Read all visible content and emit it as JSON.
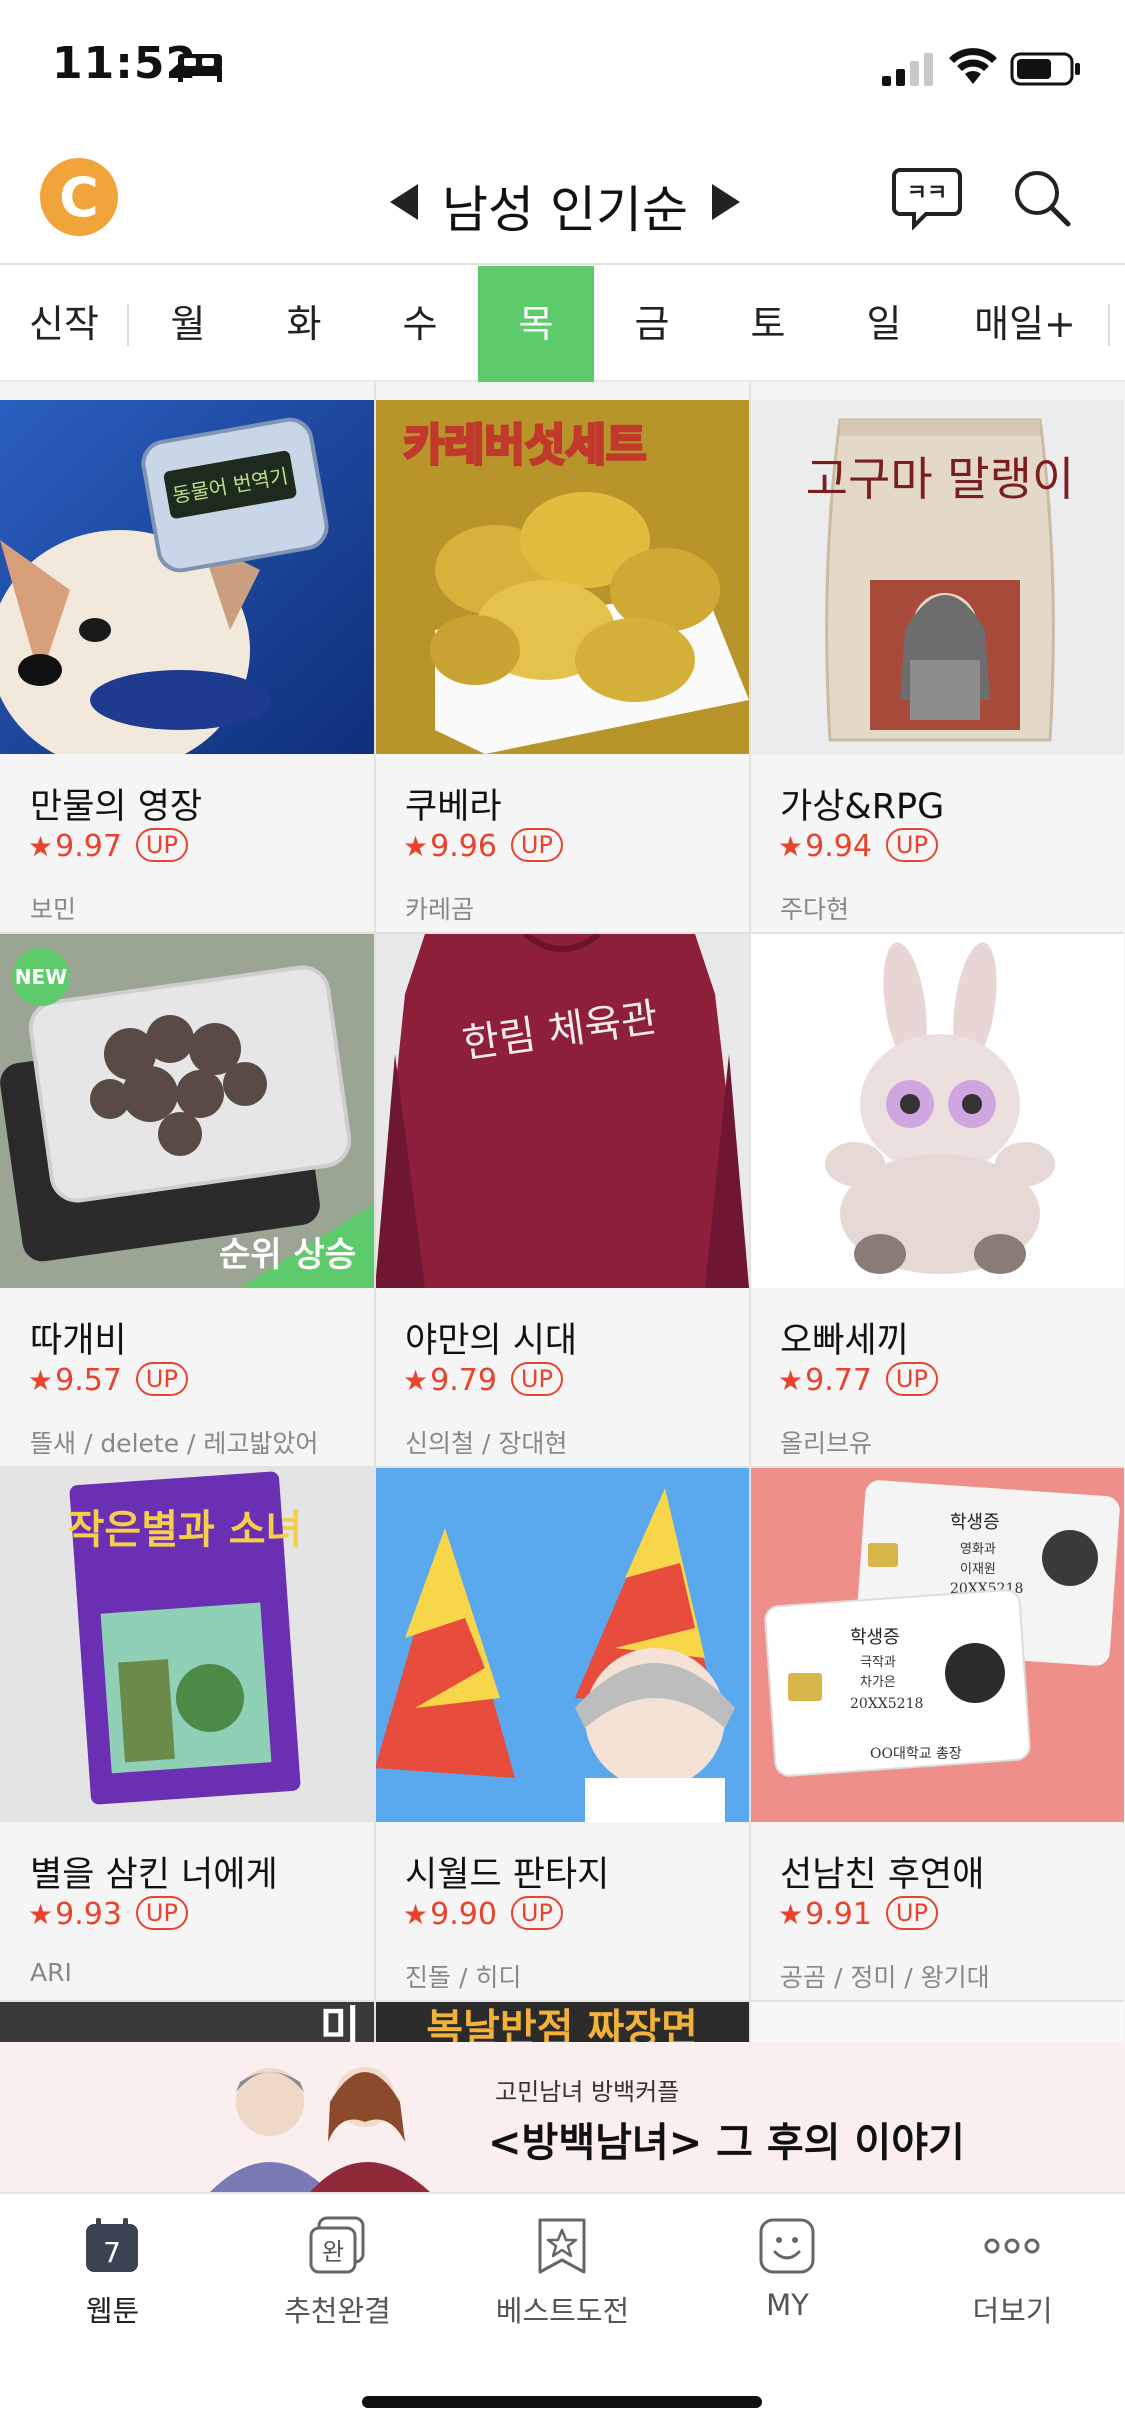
{
  "status": {
    "time": "11:52"
  },
  "header": {
    "logo_letter": "C",
    "title": "남성 인기순"
  },
  "tabs": [
    {
      "label": "신작"
    },
    {
      "label": "월"
    },
    {
      "label": "화"
    },
    {
      "label": "수"
    },
    {
      "label": "목"
    },
    {
      "label": "금"
    },
    {
      "label": "토"
    },
    {
      "label": "일"
    },
    {
      "label": "매일+"
    }
  ],
  "active_tab": "목",
  "comics": [
    {
      "title": "만물의 영장",
      "rating": "9.97",
      "badge": "UP",
      "author": "보민",
      "thumb_text": "동물어 번역기"
    },
    {
      "title": "쿠베라",
      "rating": "9.96",
      "badge": "UP",
      "author": "카레곰",
      "thumb_text": "카레버섯세트"
    },
    {
      "title": "가상&RPG",
      "rating": "9.94",
      "badge": "UP",
      "author": "주다현",
      "thumb_text": "고구마 말랭이"
    },
    {
      "title": "따개비",
      "rating": "9.57",
      "badge": "UP",
      "author": "뜰새 / delete / 레고밟았어",
      "new": "NEW",
      "rank_text": "순위 상승"
    },
    {
      "title": "야만의 시대",
      "rating": "9.79",
      "badge": "UP",
      "author": "신의철 / 장대현",
      "thumb_text": "한림 체육관"
    },
    {
      "title": "오빠세끼",
      "rating": "9.77",
      "badge": "UP",
      "author": "올리브유"
    },
    {
      "title": "별을 삼킨 너에게",
      "rating": "9.93",
      "badge": "UP",
      "author": "ARI",
      "thumb_text": "작은별과 소녀"
    },
    {
      "title": "시월드 판타지",
      "rating": "9.90",
      "badge": "UP",
      "author": "진돌 / 히디"
    },
    {
      "title": "선남친 후연애",
      "rating": "9.91",
      "badge": "UP",
      "author": "공곰 / 정미 / 왕기대",
      "card_text": [
        "학생증",
        "영화과",
        "이재원",
        "20XX5218",
        "학생증",
        "극작과",
        "차가은",
        "20XX5218",
        "OO대학교 총장"
      ]
    },
    {
      "thumb_text": "미"
    },
    {
      "thumb_text": "복날반점 짜장면"
    }
  ],
  "banner": {
    "small": "고민남녀 방백커플",
    "main": "<방백남녀> 그 후의 이야기"
  },
  "bottom_nav": [
    {
      "label": "웹툰",
      "icon": "calendar-icon",
      "badge": "7"
    },
    {
      "label": "추천완결",
      "icon": "complete-icon",
      "badge": "완"
    },
    {
      "label": "베스트도전",
      "icon": "star-bookmark-icon"
    },
    {
      "label": "MY",
      "icon": "smile-icon"
    },
    {
      "label": "더보기",
      "icon": "more-icon"
    }
  ],
  "colors": {
    "accent": "#5dcb6b",
    "rating": "#e8432e",
    "logo": "#f0a43a"
  }
}
